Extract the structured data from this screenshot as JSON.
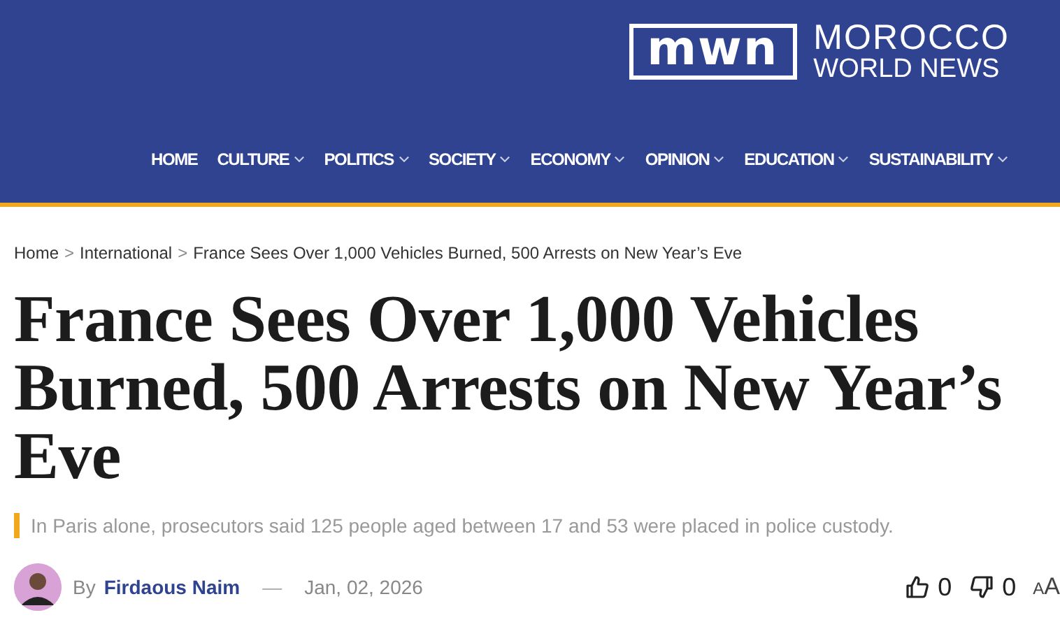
{
  "header": {
    "logo": {
      "mark": "mwn",
      "name_line_1": "MOROCCO",
      "name_line_2": "WORLD NEWS"
    },
    "nav": [
      {
        "label": "HOME",
        "has_dropdown": false
      },
      {
        "label": "CULTURE",
        "has_dropdown": true
      },
      {
        "label": "POLITICS",
        "has_dropdown": true
      },
      {
        "label": "SOCIETY",
        "has_dropdown": true
      },
      {
        "label": "ECONOMY",
        "has_dropdown": true
      },
      {
        "label": "OPINION",
        "has_dropdown": true
      },
      {
        "label": "EDUCATION",
        "has_dropdown": true
      },
      {
        "label": "SUSTAINABILITY",
        "has_dropdown": true
      }
    ]
  },
  "breadcrumb": [
    "Home",
    "International",
    "France Sees Over 1,000 Vehicles Burned, 500 Arrests on New Year’s Eve"
  ],
  "breadcrumb_separator": ">",
  "article": {
    "title": "France Sees Over 1,000 Vehicles Burned, 500 Arrests on New Year’s Eve",
    "subtitle": "In Paris alone, prosecutors said 125 people aged between 17 and 53 were placed in police custody.",
    "byline_prefix": "By",
    "author": "Firdaous Naim",
    "dash": "—",
    "date": "Jan, 02, 2026",
    "likes": "0",
    "dislikes": "0",
    "font_size_small": "A",
    "font_size_large": "A"
  }
}
